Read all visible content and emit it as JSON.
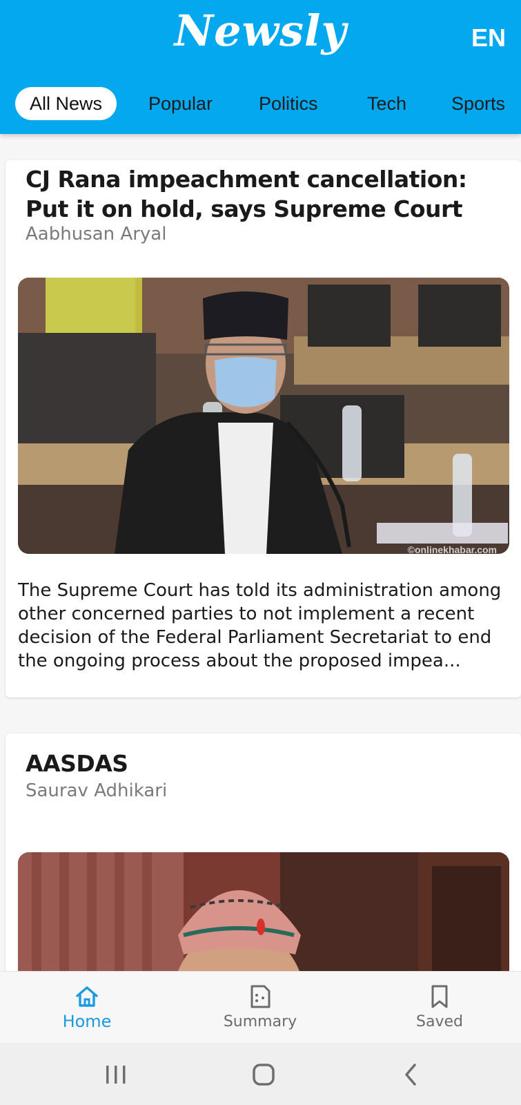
{
  "header": {
    "logo": "Newsly",
    "language": "EN",
    "accent_color": "#04a8ee"
  },
  "tabs": [
    {
      "label": "All News",
      "active": true
    },
    {
      "label": "Popular",
      "active": false
    },
    {
      "label": "Politics",
      "active": false
    },
    {
      "label": "Tech",
      "active": false
    },
    {
      "label": "Sports",
      "active": false
    }
  ],
  "articles": [
    {
      "title": "CJ Rana impeachment cancellation: Put it on hold, says Supreme Court",
      "author": "Aabhusan Aryal",
      "image": "photo-man-in-mask-and-dhaka-topi-at-meeting-table",
      "image_watermark": "©onlinekhabar.com",
      "snippet": "The Supreme Court has told its administration among other concerned parties to not implement a recent decision of the Federal Parliament Secretariat to end the ongoing process about the proposed impea..."
    },
    {
      "title": "AASDAS",
      "author": "Saurav Adhikari",
      "image": "photo-man-in-dhaka-topi-with-tika"
    }
  ],
  "bottom_nav": [
    {
      "label": "Home",
      "icon": "home-icon",
      "active": true
    },
    {
      "label": "Summary",
      "icon": "summary-icon",
      "active": false
    },
    {
      "label": "Saved",
      "icon": "bookmark-icon",
      "active": false
    }
  ],
  "system_nav": [
    "recent-apps-icon",
    "home-circle-icon",
    "back-icon"
  ]
}
